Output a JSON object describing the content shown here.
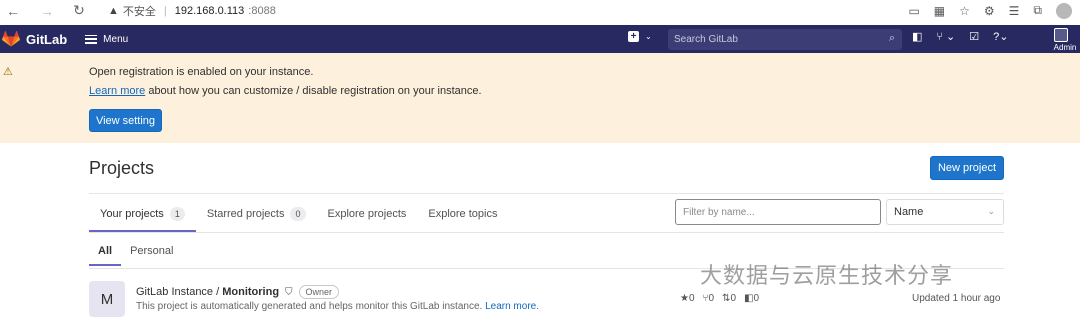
{
  "browser": {
    "insecure_label": "不安全",
    "host": "192.168.0.113",
    "port": ":8088"
  },
  "header": {
    "brand": "GitLab",
    "menu_label": "Menu",
    "search_placeholder": "Search GitLab",
    "user_label": "Admin"
  },
  "banner": {
    "title": "Open registration is enabled on your instance.",
    "link": "Learn more",
    "body": " about how you can customize / disable registration on your instance.",
    "button": "View setting"
  },
  "page": {
    "title": "Projects",
    "new_button": "New project"
  },
  "tabs": [
    {
      "label": "Your projects",
      "count": "1"
    },
    {
      "label": "Starred projects",
      "count": "0"
    },
    {
      "label": "Explore projects"
    },
    {
      "label": "Explore topics"
    }
  ],
  "filter": {
    "placeholder": "Filter by name...",
    "sort_value": "Name"
  },
  "subtabs": [
    "All",
    "Personal"
  ],
  "project": {
    "avatar_letter": "M",
    "namespace": "GitLab Instance / ",
    "name": "Monitoring",
    "role": "Owner",
    "description": "This project is automatically generated and helps monitor this GitLab instance. ",
    "desc_link": "Learn more.",
    "stars": "0",
    "forks": "0",
    "merge_requests": "0",
    "issues": "0",
    "updated": "Updated 1 hour ago"
  },
  "watermark": "大数据与云原生技术分享"
}
